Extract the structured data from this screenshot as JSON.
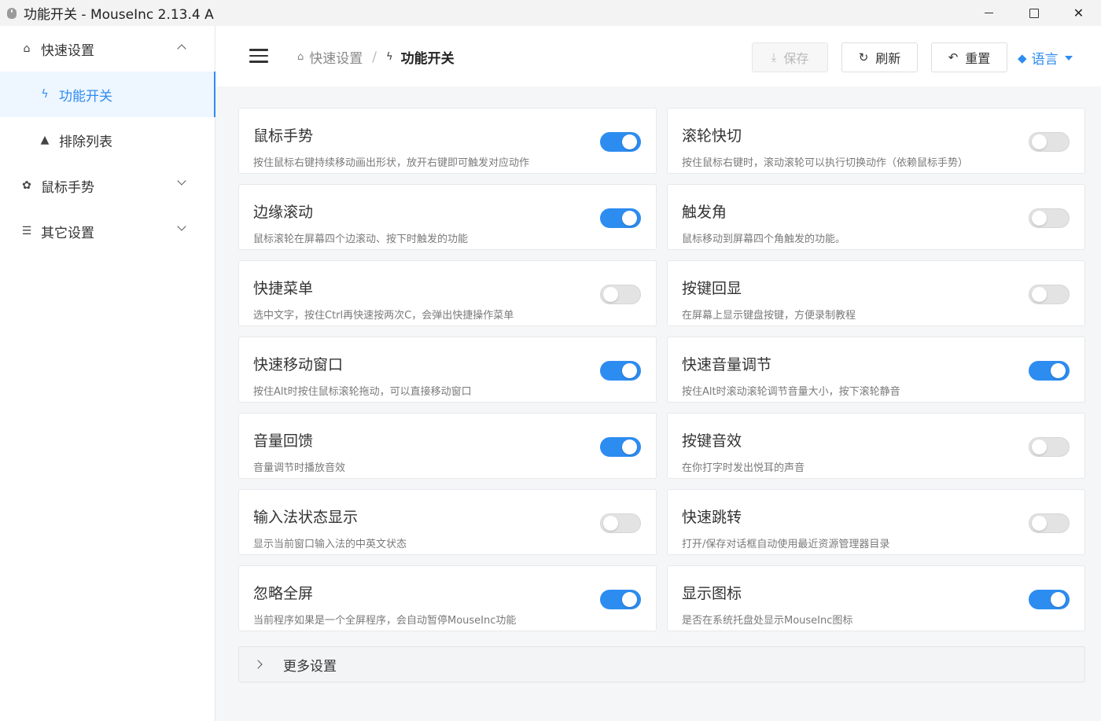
{
  "window": {
    "title": "功能开关 - MouseInc 2.13.4 A",
    "minimize": "",
    "maximize": "",
    "close": "✕"
  },
  "sidebar": {
    "items": [
      {
        "label": "快速设置",
        "icon": "home-icon",
        "glyph": "⌂",
        "expanded": true
      },
      {
        "label": "功能开关",
        "icon": "bolt-icon",
        "glyph": "ϟ",
        "active": true
      },
      {
        "label": "排除列表",
        "icon": "warning-icon",
        "glyph": "▲"
      },
      {
        "label": "鼠标手势",
        "icon": "gear-icon",
        "glyph": "✿"
      },
      {
        "label": "其它设置",
        "icon": "sliders-icon",
        "glyph": "☰"
      }
    ]
  },
  "header": {
    "breadcrumb": {
      "home": "快速设置",
      "separator": "/",
      "current": "功能开关"
    },
    "buttons": {
      "save": {
        "label": "保存",
        "icon": "download-icon",
        "glyph": "⤓",
        "disabled": true
      },
      "refresh": {
        "label": "刷新",
        "icon": "refresh-icon",
        "glyph": "↻"
      },
      "reset": {
        "label": "重置",
        "icon": "undo-icon",
        "glyph": "↶"
      }
    },
    "language": {
      "label": "语言",
      "icon": "language-icon",
      "glyph": "◆"
    }
  },
  "features": [
    {
      "title": "鼠标手势",
      "desc": "按住鼠标右键持续移动画出形状，放开右键即可触发对应动作",
      "enabled": true
    },
    {
      "title": "滚轮快切",
      "desc": "按住鼠标右键时，滚动滚轮可以执行切换动作（依赖鼠标手势）",
      "enabled": false
    },
    {
      "title": "边缘滚动",
      "desc": "鼠标滚轮在屏幕四个边滚动、按下时触发的功能",
      "enabled": true
    },
    {
      "title": "触发角",
      "desc": "鼠标移动到屏幕四个角触发的功能。",
      "enabled": false
    },
    {
      "title": "快捷菜单",
      "desc": "选中文字，按住Ctrl再快速按两次C，会弹出快捷操作菜单",
      "enabled": false
    },
    {
      "title": "按键回显",
      "desc": "在屏幕上显示键盘按键，方便录制教程",
      "enabled": false
    },
    {
      "title": "快速移动窗口",
      "desc": "按住Alt时按住鼠标滚轮拖动，可以直接移动窗口",
      "enabled": true
    },
    {
      "title": "快速音量调节",
      "desc": "按住Alt时滚动滚轮调节音量大小，按下滚轮静音",
      "enabled": true
    },
    {
      "title": "音量回馈",
      "desc": "音量调节时播放音效",
      "enabled": true
    },
    {
      "title": "按键音效",
      "desc": "在你打字时发出悦耳的声音",
      "enabled": false
    },
    {
      "title": "输入法状态显示",
      "desc": "显示当前窗口输入法的中英文状态",
      "enabled": false
    },
    {
      "title": "快速跳转",
      "desc": "打开/保存对话框自动使用最近资源管理器目录",
      "enabled": false
    },
    {
      "title": "忽略全屏",
      "desc": "当前程序如果是一个全屏程序，会自动暂停MouseInc功能",
      "enabled": true
    },
    {
      "title": "显示图标",
      "desc": "是否在系统托盘处显示MouseInc图标",
      "enabled": true
    }
  ],
  "more": {
    "label": "更多设置"
  },
  "colors": {
    "accent": "#2d8cf0",
    "toggle_off": "#e3e3e3",
    "active_bg": "#eef6ff"
  }
}
